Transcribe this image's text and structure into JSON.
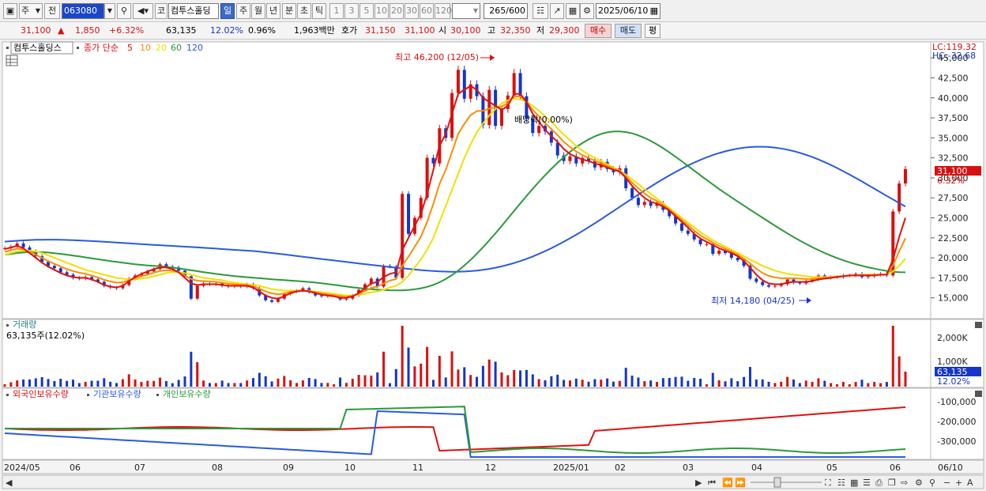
{
  "toolbar": {
    "stock_type": "주",
    "prev_label": "전",
    "code": "063080",
    "code_label": "코",
    "stock_name": "컴투스홀딩",
    "periods": [
      "일",
      "주",
      "월",
      "년",
      "분",
      "초",
      "틱"
    ],
    "active_period": "일",
    "intervals": [
      "1",
      "3",
      "5",
      "10",
      "20",
      "30",
      "60",
      "120"
    ],
    "count": "265",
    "count_total": "/600",
    "date": "2025/06/10"
  },
  "quote": {
    "price": "31,100",
    "up_arrow": "▲",
    "change": "1,850",
    "change_pct": "+6.32%",
    "volume": "63,135",
    "turnover_pct": "12.02%",
    "ratio": "0.96%",
    "amount": "1,963백만",
    "ask_label": "호가",
    "ask1": "31,150",
    "bid1": "31,100",
    "open_label": "시",
    "open": "30,100",
    "high_label": "고",
    "high": "32,350",
    "low_label": "저",
    "low": "29,300",
    "buy_label": "매수",
    "sell_label": "매도",
    "eval_label": "평"
  },
  "price_panel": {
    "name": "컴투스홀딩스",
    "indicator": "종가 단순",
    "ma_periods": [
      "5",
      "10",
      "20",
      "60",
      "120"
    ],
    "ma_colors": [
      "#e01010",
      "#ff8c00",
      "#f0e000",
      "#2a9a3a",
      "#2a5ae0"
    ],
    "lc": "LC:119.32",
    "hc": "HC:-32.68",
    "y_ticks": [
      "45,000",
      "42,500",
      "40,000",
      "37,500",
      "35,000",
      "32,500",
      "30,000",
      "27,500",
      "25,000",
      "22,500",
      "20,000",
      "17,500",
      "15,000"
    ],
    "current_tag": "31,100",
    "current_pct": "6.32%",
    "high_annot": "최고 46,200 (12/05)",
    "low_annot": "최저 14,180 (04/25)",
    "div_annot": "배당락(0.00%)"
  },
  "volume_panel": {
    "title": "거래량",
    "value_label": "63,135주(12.02%)",
    "y_ticks": [
      "2,000K",
      "1,000K"
    ],
    "current_tag": "63,135",
    "current_pct": "12.02%"
  },
  "holding_panel": {
    "legend": [
      "외국인보유수량",
      "기관보유수량",
      "개인보유수량"
    ],
    "legend_colors": [
      "#e01010",
      "#2a5ae0",
      "#2a9a3a"
    ],
    "y_ticks": [
      "-100,000",
      "-200,000",
      "-300,000"
    ]
  },
  "x_axis": [
    "2024/05",
    "06",
    "07",
    "08",
    "09",
    "10",
    "11",
    "12",
    "2025/01",
    "02",
    "03",
    "04",
    "05",
    "06",
    "06/10"
  ],
  "chart_data": {
    "type": "candlestick",
    "price_range": [
      12500,
      46500
    ],
    "annotations": [
      {
        "label": "최고",
        "value": 46200,
        "date": "12/05"
      },
      {
        "label": "최저",
        "value": 14180,
        "date": "04/25"
      }
    ],
    "close": [
      21200,
      21400,
      21800,
      21300,
      20800,
      20200,
      19500,
      19000,
      18700,
      18200,
      17900,
      17500,
      17400,
      17600,
      17300,
      17000,
      16500,
      16300,
      16200,
      16600,
      17400,
      17800,
      18000,
      18300,
      18600,
      19200,
      18900,
      18800,
      18400,
      17700,
      14900,
      16500,
      16800,
      16700,
      16800,
      16500,
      16400,
      16500,
      16400,
      16700,
      16200,
      15300,
      14700,
      14500,
      14900,
      15500,
      15800,
      15900,
      16200,
      15700,
      15300,
      15200,
      15300,
      15300,
      14800,
      14900,
      15300,
      16000,
      16700,
      17400,
      16400,
      19000,
      18900,
      17500,
      28000,
      23000,
      25000,
      27500,
      32500,
      31800,
      36200,
      35000,
      40600,
      43500,
      39900,
      41700,
      40200,
      36600,
      41000,
      36500,
      38600,
      40300,
      43100,
      40200,
      37400,
      35600,
      36500,
      35800,
      34400,
      32800,
      32100,
      32700,
      31800,
      32500,
      32100,
      31300,
      32000,
      31100,
      30700,
      31200,
      28700,
      27500,
      26600,
      27000,
      26500,
      26800,
      26000,
      25200,
      24300,
      23400,
      23000,
      22300,
      21700,
      21700,
      20500,
      20900,
      20600,
      20000,
      19700,
      19000,
      17400,
      17000,
      16600,
      16400,
      16500,
      16700,
      17300,
      16900,
      16800,
      17100,
      17300,
      17800,
      17500,
      17600,
      17600,
      17800,
      17800,
      18000,
      17600,
      17700,
      17900,
      18000,
      17800,
      25800,
      29300,
      31100
    ],
    "ma_series": {
      "ma5": [
        21100,
        21300,
        21500,
        21200,
        20600,
        20000,
        19400,
        18900,
        18500,
        18100,
        17800,
        17600,
        17500,
        17500,
        17300,
        17000,
        16600,
        16400,
        16300,
        16500,
        17100,
        17600,
        18000,
        18300,
        18600,
        18800,
        18800,
        18600,
        18200,
        17500,
        16800,
        16600,
        16700,
        16700,
        16700,
        16600,
        16500,
        16500,
        16500,
        16500,
        16300,
        15800,
        15300,
        15000,
        14900,
        15200,
        15600,
        15800,
        15900,
        15800,
        15600,
        15400,
        15300,
        15200,
        15000,
        15000,
        15200,
        15600,
        16200,
        16800,
        17000,
        17600,
        18000,
        18200,
        21000,
        22500,
        24000,
        25500,
        28000,
        31000,
        34000,
        35500,
        38000,
        40500,
        41000,
        41500,
        41000,
        40000,
        39500,
        39000,
        38500,
        39000,
        40500,
        40500,
        39500,
        38000,
        37000,
        36000,
        35200,
        34500,
        33600,
        33000,
        32600,
        32300,
        32100,
        31800,
        31600,
        31300,
        31000,
        30800,
        30000,
        29000,
        28200,
        27500,
        27000,
        26800,
        26400,
        25900,
        25200,
        24500,
        23800,
        23000,
        22400,
        22000,
        21600,
        21200,
        20900,
        20600,
        20200,
        19600,
        18800,
        17900,
        17200,
        16800,
        16700,
        16700,
        16900,
        17000,
        17000,
        17000,
        17100,
        17300,
        17400,
        17500,
        17600,
        17700,
        17800,
        17800,
        17800,
        17800,
        17800,
        17900,
        17900,
        19800,
        22600,
        25000
      ],
      "ma20": [
        20400,
        20600,
        20800,
        20900,
        20900,
        20800,
        20600,
        20300,
        20000,
        19700,
        19400,
        19100,
        18800,
        18500,
        18300,
        18100,
        17900,
        17700,
        17500,
        17400,
        17300,
        17300,
        17400,
        17500,
        17700,
        17900,
        18100,
        18200,
        18200,
        18100,
        17900,
        17700,
        17500,
        17400,
        17300,
        17200,
        17000,
        16900,
        16800,
        16700,
        16600,
        16500,
        16300,
        16100,
        16000,
        15900,
        15900,
        15900,
        15900,
        15900,
        15800,
        15700,
        15600,
        15500,
        15400,
        15300,
        15300,
        15400,
        15500,
        15700,
        15800,
        16000,
        16300,
        16500,
        17000,
        17800,
        18800,
        19800,
        21000,
        22500,
        24500,
        26500,
        28500,
        30500,
        32500,
        34200,
        35700,
        36800,
        37800,
        38600,
        39300,
        39700,
        39900,
        39800,
        39500,
        39000,
        38400,
        37700,
        37000,
        36200,
        35400,
        34700,
        34000,
        33400,
        32900,
        32500,
        32100,
        31700,
        31300,
        30900,
        30400,
        29800,
        29200,
        28600,
        28000,
        27400,
        26800,
        26200,
        25600,
        25000,
        24400,
        23800,
        23200,
        22700,
        22200,
        21800,
        21400,
        21000,
        20600,
        20200,
        19800,
        19400,
        19000,
        18700,
        18400,
        18200,
        18000,
        17900,
        17800,
        17700,
        17600,
        17600,
        17600,
        17600,
        17700,
        17700,
        17800,
        17800,
        17900,
        17900,
        17900,
        17900,
        17900,
        18300,
        19000,
        19900
      ]
    }
  }
}
